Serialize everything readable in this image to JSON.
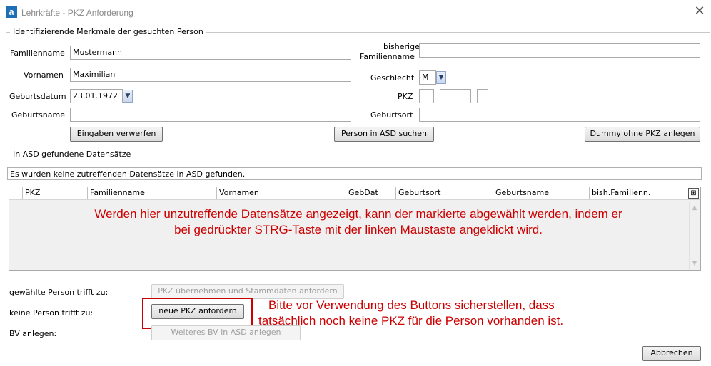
{
  "window": {
    "title": "Lehrkräfte - PKZ Anforderung",
    "app_icon_letter": "a",
    "close_glyph": "✕"
  },
  "section1": {
    "title": "Identifizierende Merkmale der gesuchten Person",
    "familienname_label": "Familienname",
    "familienname_value": "Mustermann",
    "bisheriger_label_line1": "bisheriger",
    "bisheriger_label_line2": "Familienname",
    "bisheriger_value": "",
    "vornamen_label": "Vornamen",
    "vornamen_value": "Maximilian",
    "geschlecht_label": "Geschlecht",
    "geschlecht_value": "M",
    "geburtsdatum_label": "Geburtsdatum",
    "geburtsdatum_value": "23.01.1972",
    "pkz_label": "PKZ",
    "pkz_part1": "",
    "pkz_part2": "",
    "pkz_part3": "",
    "geburtsname_label": "Geburtsname",
    "geburtsname_value": "",
    "geburtsort_label": "Geburtsort",
    "geburtsort_value": "",
    "btn_verwerfen": "Eingaben verwerfen",
    "btn_suchen": "Person in ASD suchen",
    "btn_dummy": "Dummy ohne PKZ anlegen"
  },
  "section2": {
    "title": "In ASD gefundene Datensätze",
    "status_text": "Es wurden keine zutreffenden Datensätze in ASD gefunden.",
    "columns": [
      "PKZ",
      "Familienname",
      "Vornamen",
      "GebDat",
      "Geburtsort",
      "Geburtsname",
      "bish.Familienn."
    ],
    "rows": []
  },
  "actions": {
    "gewaehlte_label": "gewählte Person trifft zu:",
    "gewaehlte_button": "PKZ übernehmen und Stammdaten anfordern",
    "keine_label": "keine Person trifft zu:",
    "keine_button": "neue PKZ anfordern",
    "bv_label": "BV anlegen:",
    "bv_button": "Weiteres BV in ASD anlegen",
    "abbrechen": "Abbrechen"
  },
  "annotations": {
    "note1_line1": "Werden hier unzutreffende Datensätze angezeigt, kann der markierte abgewählt werden, indem er",
    "note1_line2": "bei gedrückter STRG-Taste mit der linken Maustaste angeklickt wird.",
    "note2_line1": "Bitte vor Verwendung des Buttons sicherstellen, dass",
    "note2_line2": "tatsächlich noch keine PKZ für die Person vorhanden ist.",
    "color": "#cc0000"
  }
}
